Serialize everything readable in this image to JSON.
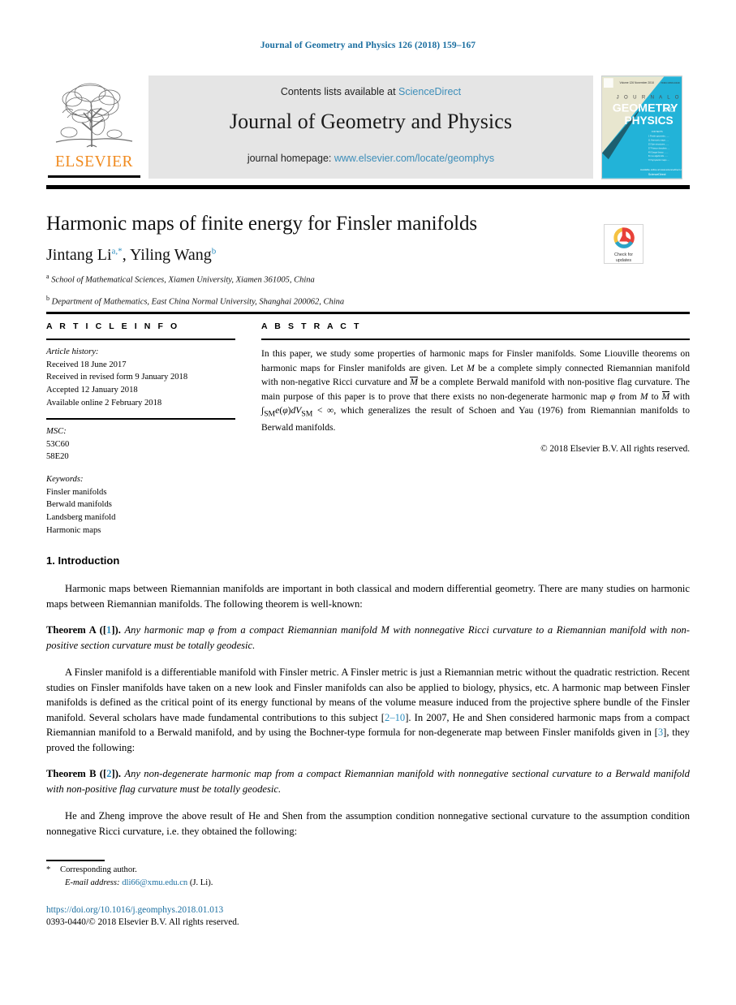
{
  "running_head": "Journal of Geometry and Physics 126 (2018) 159–167",
  "masthead": {
    "publisher_name": "ELSEVIER",
    "contents_prefix": "Contents lists available at ",
    "contents_link": "ScienceDirect",
    "journal_title": "Journal of Geometry and Physics",
    "homepage_prefix": "journal homepage: ",
    "homepage_link": "www.elsevier.com/locate/geomphys",
    "cover": {
      "line1": "JOURNAL OF",
      "line2": "GEOMETRY",
      "line3": "AND",
      "line4": "PHYSICS"
    }
  },
  "article": {
    "title": "Harmonic maps of finite energy for Finsler manifolds",
    "authors": [
      {
        "name": "Jintang Li",
        "marks": "a,*"
      },
      {
        "name": "Yiling Wang",
        "marks": "b"
      }
    ],
    "authors_separator": ", ",
    "affiliations": [
      {
        "mark": "a",
        "text": "School of Mathematical Sciences, Xiamen University, Xiamen 361005, China"
      },
      {
        "mark": "b",
        "text": "Department of Mathematics, East China Normal University, Shanghai 200062, China"
      }
    ]
  },
  "crossmark": {
    "line1": "Check for",
    "line2": "updates"
  },
  "info": {
    "heading": "A R T I C L E   I N F O",
    "history_label": "Article history:",
    "history": [
      "Received 18 June 2017",
      "Received in revised form 9 January 2018",
      "Accepted 12 January 2018",
      "Available online 2 February 2018"
    ],
    "msc_label": "MSC:",
    "msc": [
      "53C60",
      "58E20"
    ],
    "keywords_label": "Keywords:",
    "keywords": [
      "Finsler manifolds",
      "Berwald manifolds",
      "Landsberg manifold",
      "Harmonic maps"
    ]
  },
  "abstract": {
    "heading": "A B S T R A C T",
    "p1_a": "In this paper, we study some properties of harmonic maps for Finsler manifolds. Some Liouville theorems on harmonic maps for Finsler manifolds are given. Let ",
    "m1": "M",
    "p1_b": " be a complete simply connected Riemannian manifold with non-negative Ricci curvature and ",
    "m2": "M",
    "p1_c": " be a complete Berwald manifold with non-positive flag curvature. The main purpose of this paper is to prove that there exists no non-degenerate harmonic map ",
    "m3": "φ",
    "p1_d": " from ",
    "m4": "M",
    "p1_e": " to ",
    "m5": "M",
    "p1_f": " with ",
    "integral": "∫",
    "sub1": "SM",
    "m6": "e",
    "p1_g": "(",
    "m7": "φ",
    "p1_h": ")",
    "m8": "dV",
    "sub2": "SM",
    "p1_i": "  <  ∞, which generalizes the result of Schoen and Yau (1976) from Riemannian manifolds to Berwald manifolds.",
    "copyright": "© 2018 Elsevier B.V. All rights reserved."
  },
  "body": {
    "section_number_title": "1.  Introduction",
    "p1": "Harmonic maps between Riemannian manifolds are important in both classical and modern differential geometry. There are many studies on harmonic maps between Riemannian manifolds. The following theorem is well-known:",
    "theoremA": {
      "name": "Theorem A",
      "cite_open": " ([",
      "cite": "1",
      "cite_close": "]). ",
      "text_a": "Any harmonic map ",
      "sym": "φ",
      "text_b": " from a compact Riemannian manifold M with nonnegative Ricci curvature to a Riemannian manifold with non-positive section curvature must be totally geodesic."
    },
    "p2_a": "A Finsler manifold is a differentiable manifold with Finsler metric. A Finsler metric is just a Riemannian metric without the quadratic restriction. Recent studies on Finsler manifolds have taken on a new look and Finsler manifolds can also be applied to biology, physics, etc. A harmonic map between Finsler manifolds is defined as the critical point of its energy functional by means of the volume measure induced from the projective sphere bundle of the Finsler manifold. Several scholars have made fundamental contributions to this subject [",
    "p2_cite1": "2–10",
    "p2_b": "]. In 2007, He and Shen considered harmonic maps from a compact Riemannian manifold to a Berwald manifold, and by using the Bochner-type formula for non-degenerate map between Finsler manifolds given in [",
    "p2_cite2": "3",
    "p2_c": "], they proved the following:",
    "theoremB": {
      "name": "Theorem B",
      "cite_open": " ([",
      "cite": "2",
      "cite_close": "]). ",
      "text": "Any non-degenerate harmonic map from a compact Riemannian manifold with nonnegative sectional curvature to a Berwald manifold with non-positive flag curvature must be totally geodesic."
    },
    "p3": "He and Zheng improve the above result of He and Shen from the assumption condition nonnegative sectional curvature to the assumption condition nonnegative Ricci curvature, i.e. they obtained the following:"
  },
  "footer": {
    "corresponding": "Corresponding author.",
    "email_label": "E-mail address:",
    "email": "dli66@xmu.edu.cn",
    "email_suffix": " (J. Li).",
    "doi": "https://doi.org/10.1016/j.geomphys.2018.01.013",
    "issn": "0393-0440/© 2018 Elsevier B.V. All rights reserved."
  },
  "colors": {
    "link_blue": "#3d8eb9",
    "cite_blue": "#2b8cbe",
    "running_head_blue": "#1a6ea0",
    "elsevier_orange": "#f08a1e",
    "band_gray": "#e5e5e5"
  }
}
